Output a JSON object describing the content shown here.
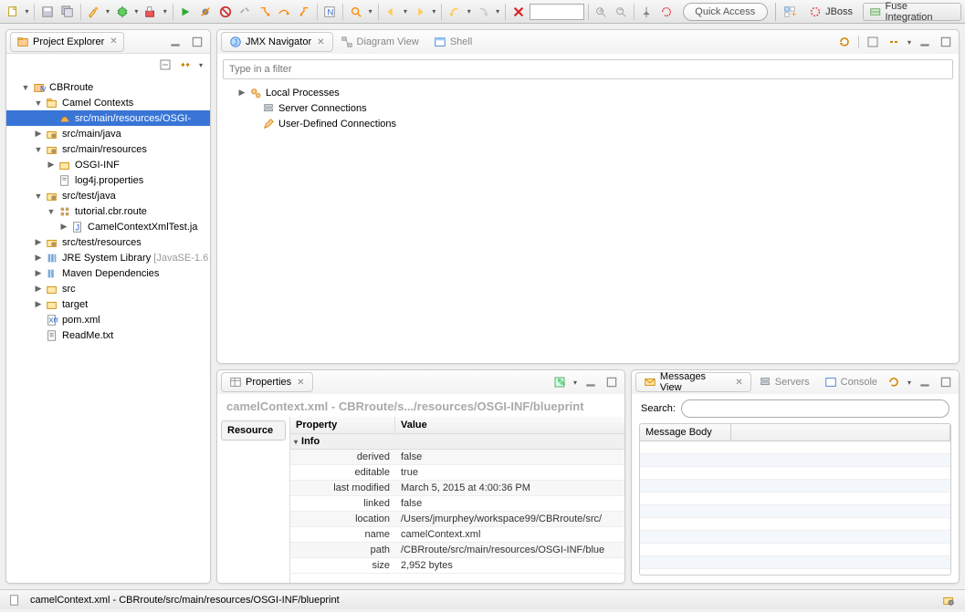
{
  "toolbar": {
    "quick_access": "Quick Access",
    "perspectives": [
      {
        "name": "JBoss",
        "key": "jboss"
      },
      {
        "name": "Fuse Integration",
        "key": "fuse"
      }
    ]
  },
  "project_explorer": {
    "title": "Project Explorer",
    "tree": {
      "root": "CBRroute",
      "camel_ctx": "Camel Contexts",
      "sel": "src/main/resources/OSGI-",
      "p1": "src/main/java",
      "p2": "src/main/resources",
      "p2a": "OSGI-INF",
      "p2b": "log4j.properties",
      "p3": "src/test/java",
      "p3a": "tutorial.cbr.route",
      "p3a1": "CamelContextXmlTest.ja",
      "p4": "src/test/resources",
      "jre": "JRE System Library",
      "jre_hint": "[JavaSE-1.6",
      "maven": "Maven Dependencies",
      "src": "src",
      "target": "target",
      "pom": "pom.xml",
      "readme": "ReadMe.txt"
    }
  },
  "jmx": {
    "tab1": "JMX Navigator",
    "tab2": "Diagram View",
    "tab3": "Shell",
    "filter_placeholder": "Type in a filter",
    "n1": "Local Processes",
    "n2": "Server Connections",
    "n3": "User-Defined Connections"
  },
  "props": {
    "tab": "Properties",
    "heading": "camelContext.xml - CBRroute/s.../resources/OSGI-INF/blueprint",
    "side": "Resource",
    "col1": "Property",
    "col2": "Value",
    "group": "Info",
    "rows": [
      {
        "k": "derived",
        "v": "false"
      },
      {
        "k": "editable",
        "v": "true"
      },
      {
        "k": "last modified",
        "v": "March 5, 2015 at 4:00:36 PM"
      },
      {
        "k": "linked",
        "v": "false"
      },
      {
        "k": "location",
        "v": "/Users/jmurphey/workspace99/CBRroute/src/"
      },
      {
        "k": "name",
        "v": "camelContext.xml"
      },
      {
        "k": "path",
        "v": "/CBRroute/src/main/resources/OSGI-INF/blue"
      },
      {
        "k": "size",
        "v": "2,952  bytes"
      }
    ]
  },
  "messages": {
    "tab1": "Messages View",
    "tab2": "Servers",
    "tab3": "Console",
    "search_label": "Search:",
    "col": "Message Body"
  },
  "status": {
    "text": "camelContext.xml - CBRroute/src/main/resources/OSGI-INF/blueprint"
  }
}
